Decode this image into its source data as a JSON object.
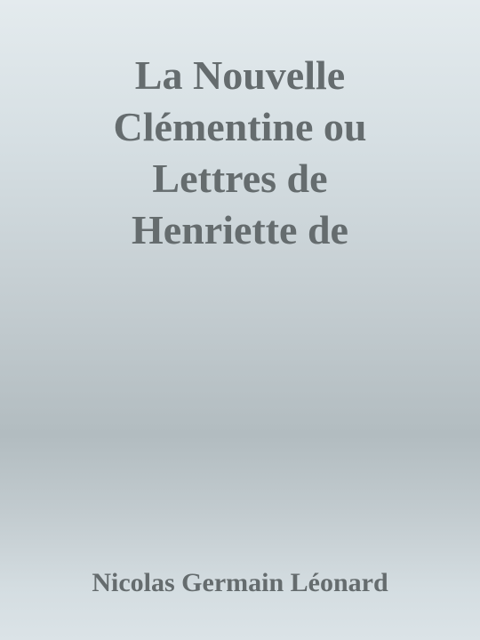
{
  "cover": {
    "title_lines": [
      "La Nouvelle",
      "Clémentine ou",
      "Lettres de",
      "Henriette de"
    ],
    "author": "Nicolas Germain Léonard"
  },
  "colors": {
    "text": "#656c6e",
    "background_top": "#e4ebee",
    "background_middle": "#b2bcc0",
    "background_bottom": "#dbe3e7"
  }
}
